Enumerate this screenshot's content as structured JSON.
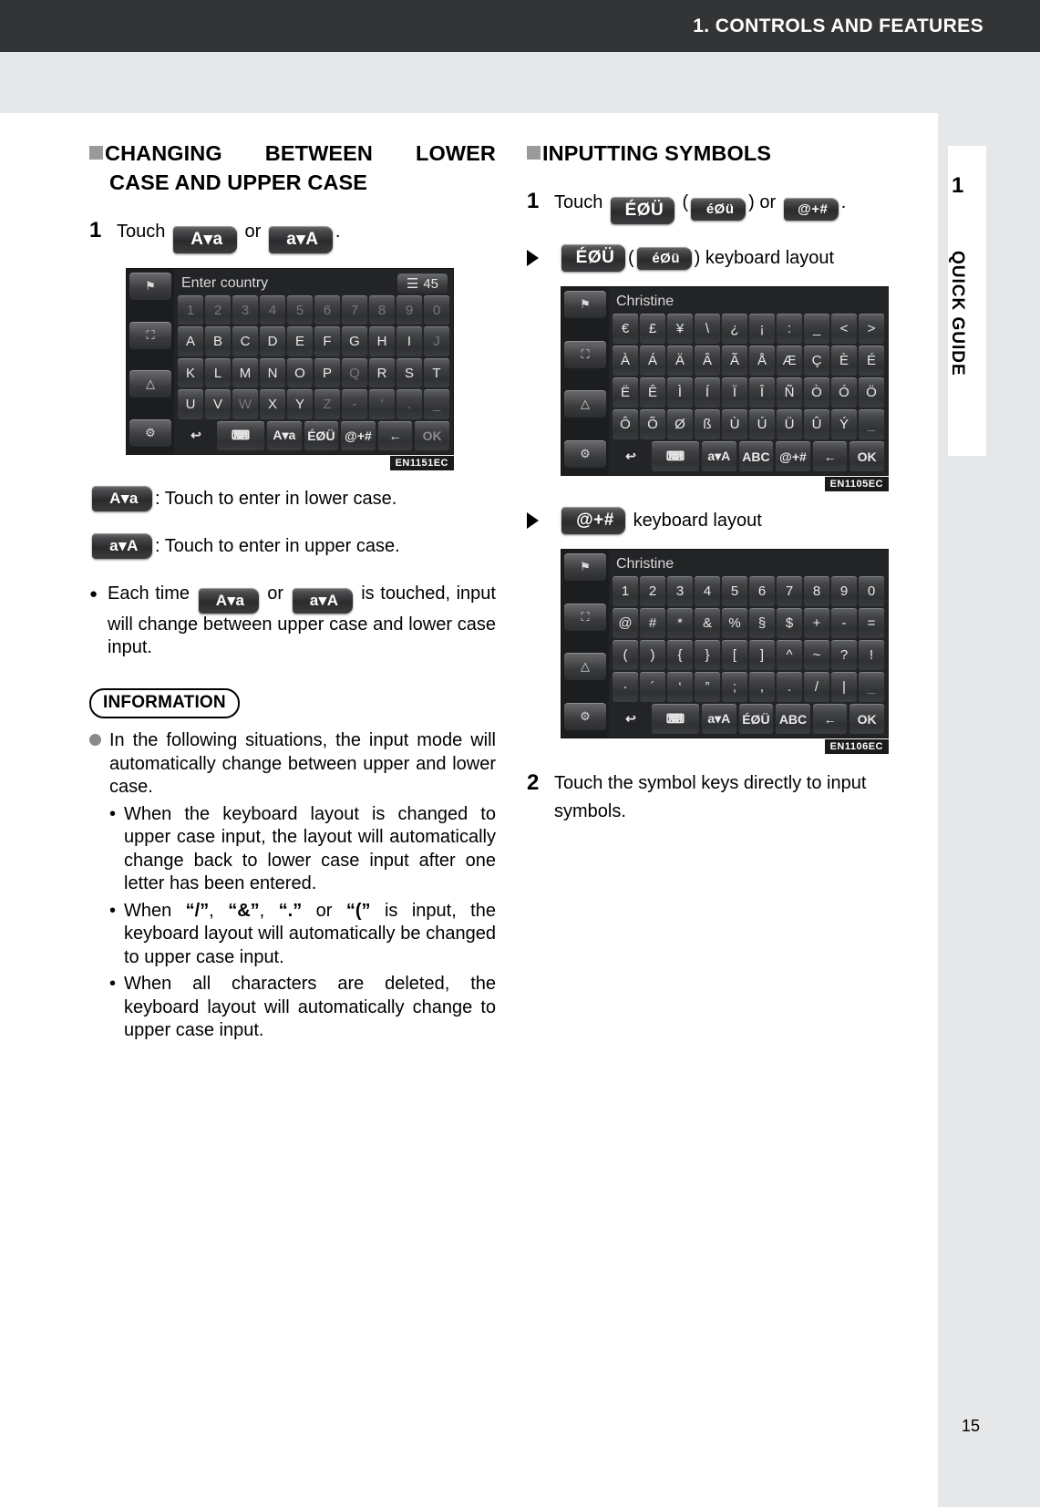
{
  "header": {
    "title": "1. CONTROLS AND FEATURES"
  },
  "side_tab": {
    "number": "1",
    "label": "QUICK GUIDE"
  },
  "page_number": "15",
  "left_column": {
    "heading_line1": "CHANGING BETWEEN LOWER",
    "heading_line2": "CASE AND UPPER CASE",
    "step1": {
      "number": "1",
      "text_before": "Touch",
      "key_a_to_lower": "A▾a",
      "text_or": "or",
      "key_a_to_upper": "a▾A",
      "text_after": "."
    },
    "screen1": {
      "title": "Enter country",
      "count": "45",
      "tag": "EN1151EC",
      "rows": [
        [
          "1",
          "2",
          "3",
          "4",
          "5",
          "6",
          "7",
          "8",
          "9",
          "0"
        ],
        [
          "A",
          "B",
          "C",
          "D",
          "E",
          "F",
          "G",
          "H",
          "I",
          "J"
        ],
        [
          "K",
          "L",
          "M",
          "N",
          "O",
          "P",
          "Q",
          "R",
          "S",
          "T"
        ],
        [
          "U",
          "V",
          "W",
          "X",
          "Y",
          "Z",
          "-",
          "'",
          ".",
          "_"
        ]
      ],
      "function_keys": [
        "↩",
        "keyboard",
        "A▾a",
        "ÉØÜ",
        "@+#",
        "←",
        "OK"
      ]
    },
    "def1": {
      "key": "A▾a",
      "text": ": Touch to enter in lower case."
    },
    "def2": {
      "key": "a▾A",
      "text": ": Touch to enter in upper case."
    },
    "bullet1": {
      "part1": "Each time",
      "key1": "A▾a",
      "part2": "or",
      "key2": "a▾A",
      "part3": "is touched, input will change between upper case and lower case input."
    },
    "information": {
      "label": "INFORMATION",
      "item1": "In the following situations, the input mode will automatically change between upper and lower case.",
      "sub1": "When the keyboard layout is changed to upper case input, the layout will automatically change back to lower case input after one letter has been entered.",
      "sub2_pre": "When ",
      "sub2_q1": "“/”",
      "sub2_c1": ", ",
      "sub2_q2": "“&”",
      "sub2_c2": ", ",
      "sub2_q3": "“.”",
      "sub2_c3": " or ",
      "sub2_q4": "“(”",
      "sub2_post": " is input, the keyboard layout will automatically be changed to upper case input.",
      "sub3": "When all characters are deleted, the keyboard layout will automatically change to upper case input."
    }
  },
  "right_column": {
    "heading": "INPUTTING SYMBOLS",
    "step1": {
      "number": "1",
      "text_before": "Touch",
      "key_upper_accent": "ÉØÜ",
      "paren_open": "(",
      "key_lower_accent": "éØü",
      "paren_close": ")",
      "text_or": "or",
      "key_symbols": "@+#",
      "text_after": "."
    },
    "sub_head1": {
      "key_upper_accent": "ÉØÜ",
      "paren_open": "(",
      "key_lower_accent": "éØü",
      "paren_close": ")",
      "text": "keyboard layout"
    },
    "screen2": {
      "title": "Christine",
      "tag": "EN1105EC",
      "rows": [
        [
          "€",
          "£",
          "¥",
          "\\",
          "¿",
          "¡",
          ":",
          "_",
          "<",
          ">"
        ],
        [
          "À",
          "Á",
          "Ä",
          "Â",
          "Ã",
          "Å",
          "Æ",
          "Ç",
          "È",
          "É"
        ],
        [
          "Ë",
          "Ê",
          "Ì",
          "Í",
          "Ï",
          "Î",
          "Ñ",
          "Ò",
          "Ó",
          "Ö"
        ],
        [
          "Ô",
          "Õ",
          "Ø",
          "ß",
          "Ù",
          "Ú",
          "Ü",
          "Û",
          "Ý",
          "_"
        ]
      ],
      "function_keys": [
        "↩",
        "keyboard",
        "a▾A",
        "ABC",
        "@+#",
        "←",
        "OK"
      ]
    },
    "sub_head2": {
      "key_symbols": "@+#",
      "text": "keyboard layout"
    },
    "screen3": {
      "title": "Christine",
      "tag": "EN1106EC",
      "rows": [
        [
          "1",
          "2",
          "3",
          "4",
          "5",
          "6",
          "7",
          "8",
          "9",
          "0"
        ],
        [
          "@",
          "#",
          "*",
          "&",
          "%",
          "§",
          "$",
          "+",
          "-",
          "="
        ],
        [
          "(",
          ")",
          "{",
          "}",
          "[",
          "]",
          "^",
          "~",
          "?",
          "!"
        ],
        [
          "·",
          "´",
          "‘",
          "”",
          ";",
          ",",
          ".",
          "/",
          "|",
          "_"
        ]
      ],
      "function_keys": [
        "↩",
        "keyboard",
        "a▾A",
        "ÉØÜ",
        "ABC",
        "←",
        "OK"
      ]
    },
    "step2": {
      "number": "2",
      "text": "Touch the symbol keys directly to input symbols."
    }
  },
  "colors": {
    "header_bg": "#333436",
    "band_bg": "#e6e7e8",
    "screen_bg": "#232426",
    "marker_gray": "#9a9a9a"
  }
}
